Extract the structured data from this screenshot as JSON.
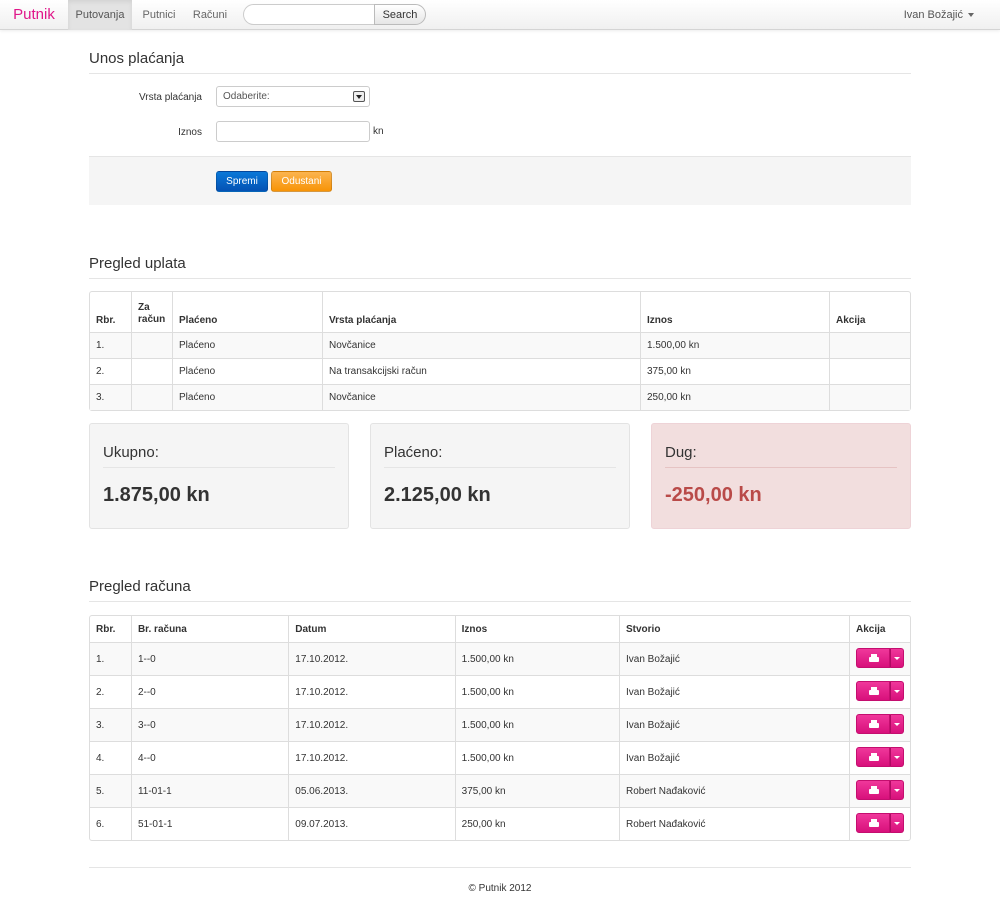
{
  "navbar": {
    "brand": "Putnik",
    "items": [
      {
        "label": "Putovanja",
        "active": true
      },
      {
        "label": "Putnici",
        "active": false
      },
      {
        "label": "Računi",
        "active": false
      }
    ],
    "search_button": "Search",
    "search_placeholder": "",
    "user": "Ivan Božajić"
  },
  "form": {
    "title": "Unos plaćanja",
    "payment_type_label": "Vrsta plaćanja",
    "payment_type_value": "Odaberite:",
    "amount_label": "Iznos",
    "amount_value": "",
    "amount_suffix": "kn",
    "save_label": "Spremi",
    "cancel_label": "Odustani"
  },
  "payments": {
    "title": "Pregled uplata",
    "headers": [
      "Rbr.",
      "Za račun",
      "Plaćeno",
      "Vrsta plaćanja",
      "Iznos",
      "Akcija"
    ],
    "rows": [
      {
        "rbr": "1.",
        "za_racun": "",
        "placeno": "Plaćeno",
        "vrsta": "Novčanice",
        "iznos": "1.500,00 kn",
        "akcija": ""
      },
      {
        "rbr": "2.",
        "za_racun": "",
        "placeno": "Plaćeno",
        "vrsta": "Na transakcijski račun",
        "iznos": "375,00 kn",
        "akcija": ""
      },
      {
        "rbr": "3.",
        "za_racun": "",
        "placeno": "Plaćeno",
        "vrsta": "Novčanice",
        "iznos": "250,00 kn",
        "akcija": ""
      }
    ]
  },
  "summary": {
    "total_label": "Ukupno:",
    "total_value": "1.875,00 kn",
    "paid_label": "Plaćeno:",
    "paid_value": "2.125,00 kn",
    "debt_label": "Dug:",
    "debt_value": "-250,00 kn",
    "debt_color": "#b94a48"
  },
  "invoices": {
    "title": "Pregled računa",
    "headers": [
      "Rbr.",
      "Br. računa",
      "Datum",
      "Iznos",
      "Stvorio",
      "Akcija"
    ],
    "rows": [
      {
        "rbr": "1.",
        "broj": "1--0",
        "datum": "17.10.2012.",
        "iznos": "1.500,00 kn",
        "stvorio": "Ivan Božajić"
      },
      {
        "rbr": "2.",
        "broj": "2--0",
        "datum": "17.10.2012.",
        "iznos": "1.500,00 kn",
        "stvorio": "Ivan Božajić"
      },
      {
        "rbr": "3.",
        "broj": "3--0",
        "datum": "17.10.2012.",
        "iznos": "1.500,00 kn",
        "stvorio": "Ivan Božajić"
      },
      {
        "rbr": "4.",
        "broj": "4--0",
        "datum": "17.10.2012.",
        "iznos": "1.500,00 kn",
        "stvorio": "Ivan Božajić"
      },
      {
        "rbr": "5.",
        "broj": "11-01-1",
        "datum": "05.06.2013.",
        "iznos": "375,00 kn",
        "stvorio": "Robert Nađaković"
      },
      {
        "rbr": "6.",
        "broj": "51-01-1",
        "datum": "09.07.2013.",
        "iznos": "250,00 kn",
        "stvorio": "Robert Nađaković"
      }
    ],
    "action_icon": "printer-icon",
    "action_color": "#e0178a"
  },
  "footer": {
    "text": "© Putnik 2012"
  }
}
